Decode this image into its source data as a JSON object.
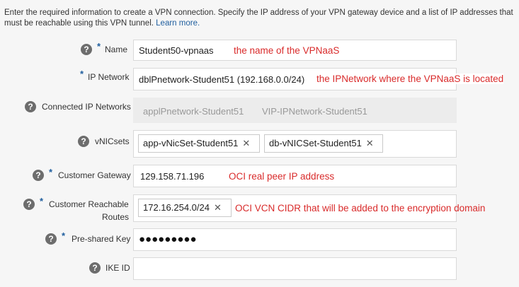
{
  "intro": {
    "text": "Enter the required information to create a VPN connection. Specify the IP address of your VPN gateway device and a list of IP addresses that must be reachable using this VPN tunnel.",
    "link": "Learn more."
  },
  "help_glyph": "?",
  "required_mark": "*",
  "remove_glyph": "✕",
  "fields": {
    "name": {
      "label": "Name",
      "value": "Student50-vpnaas",
      "annotation": "the name of the VPNaaS"
    },
    "ip_network": {
      "label": "IP Network",
      "value": "dblPnetwork-Student51 (192.168.0.0/24)",
      "annotation": "the IPNetwork where the VPNaaS is located"
    },
    "connected_networks": {
      "label": "Connected IP Networks",
      "values": [
        "applPnetwork-Student51",
        "VIP-IPNetwork-Student51"
      ]
    },
    "vnicsets": {
      "label": "vNICsets",
      "chips": [
        "app-vNicSet-Student51",
        "db-vNICSet-Student51"
      ]
    },
    "customer_gateway": {
      "label": "Customer Gateway",
      "value": "129.158.71.196",
      "annotation": "OCI real peer IP address"
    },
    "reachable_routes": {
      "label_line1": "Customer Reachable",
      "label_line2": "Routes",
      "chip": "172.16.254.0/24",
      "annotation": "OCI VCN CIDR that will be added to the encryption domain"
    },
    "preshared_key": {
      "label": "Pre-shared Key",
      "value": "●●●●●●●●●"
    },
    "ike_id": {
      "label": "IKE ID",
      "value": ""
    }
  }
}
